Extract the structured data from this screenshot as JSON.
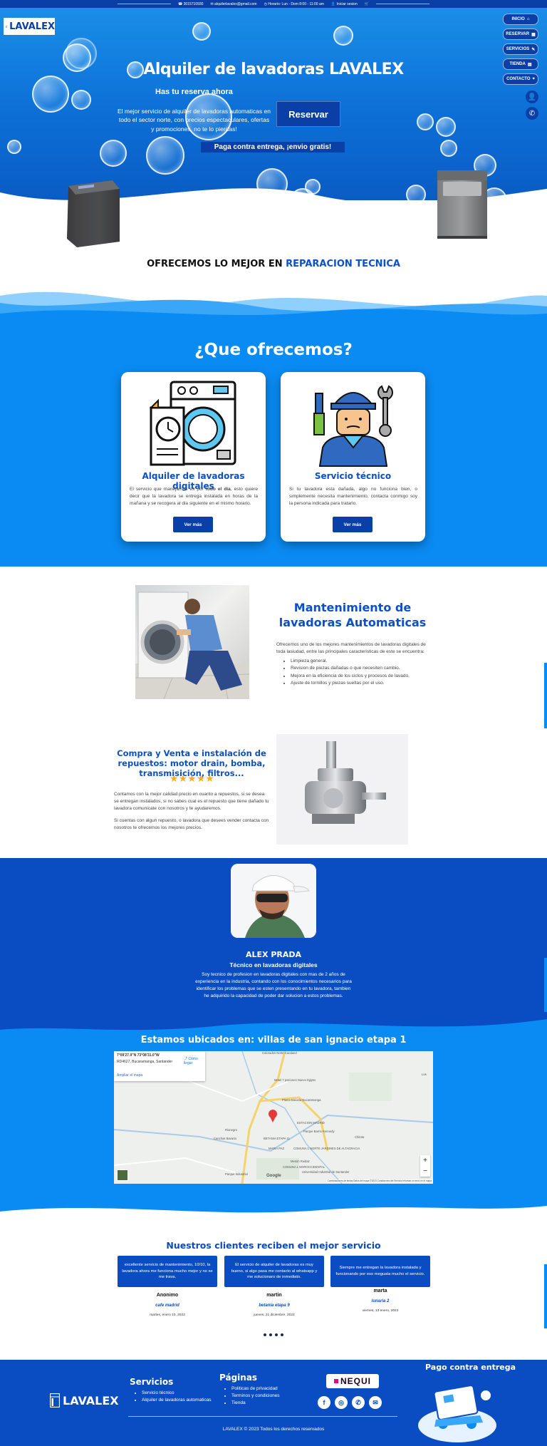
{
  "topbar": {
    "phone": "3015710930",
    "email": "alquilerlavalex@gmail.com",
    "hours": "Horario: Lun - Dom 8:00 - 11:00 am",
    "login": "Iniciar sesion"
  },
  "brand": {
    "name": "LAVALEX"
  },
  "nav": [
    {
      "label": "INICIO",
      "icon": "home-icon",
      "glyph": "⌂"
    },
    {
      "label": "RESERVAR",
      "icon": "calendar-icon",
      "glyph": "▦"
    },
    {
      "label": "SERVICIOS",
      "icon": "wrench-icon",
      "glyph": "✎"
    },
    {
      "label": "TIENDA",
      "icon": "store-icon",
      "glyph": "▤"
    },
    {
      "label": "CONTACTO",
      "icon": "location-icon",
      "glyph": "⌖"
    }
  ],
  "hero": {
    "title": "Alquiler de lavadoras LAVALEX",
    "subtitle": "Has tu reserva ahora",
    "description": "El mejor servicio de alquiler de lavadoras automaticas en todo el sector norte, con precios espectaculares, ofertas y promociones, no te lo pierdas!",
    "reserve_button": "Reservar",
    "pay_banner": "Paga contra entrega, ¡envio gratis!"
  },
  "offer_line": {
    "prefix": "OFRECEMOS LO MEJOR EN",
    "highlight": "REPARACION TECNICA"
  },
  "services": {
    "title": "¿Que ofrecemos?",
    "cards": [
      {
        "title": "Alquiler de lavadoras digitales",
        "text_pre": "El servicio que manejamos es por ",
        "text_bold": "todo el dia",
        "text_post": ", esto quiere decir que la lavadora se entrega instalada en horas de la mañana y se recogera al dia siguiente en el mismo horario.",
        "button": "Ver más"
      },
      {
        "title": "Servicio técnico",
        "text": "Si tu lavadora esta dañada, algo no funciona bien, o simplemente necesita mantenimiento, contacta conmigo soy la persona indicada para tratarlo.",
        "button": "Ver más"
      }
    ]
  },
  "maintenance": {
    "title": "Mantenimiento de lavadoras Automaticas",
    "description": "Ofrecemos uno de los mejores mantenimientos de lavadoras digitales de toda lasiudad, entre las principales caracteristicas de este se encuentra:",
    "items": [
      "Limpieza general.",
      "Revision de piezas dañadas o que necesiten cambio.",
      "Mejora en la eficiencia de los ciclos y procesos de lavado.",
      "Ajuste de tornillos y piezas sueltas por el uso."
    ]
  },
  "parts": {
    "title": "Compra y Venta e instalación de repuestos: motor drain, bomba, transmisición, filtros...",
    "rating": 5,
    "paragraph1": "Contamos con la mejor calidad precio en cuanto a repuestos, si se desea se entregan instalados, si no sabes cual es el repuesto que tiene dañado tu lavadora comunicate con nosotros y te ayudaremos.",
    "paragraph2": "Si cuentas con algun repuesto, o lavadora que desees vender contacta con nosotros te ofrecemos los mejores precios."
  },
  "profile": {
    "name": "ALEX PRADA",
    "role": "Técnico en lavadoras digitales",
    "description": "Soy tecnico de profesion en lavadoras digitales con mas de 2 años de experiencia en la industria, contando con los conocimientos necesarios para identificar los problemas que se esten presentando en tu lavadora, tambien he adquirido la capacidad de poder dar solucion a estos problemas."
  },
  "location": {
    "title": "Estamos ubicados en: villas de san ignacio etapa 1",
    "map": {
      "coords": "7°09'27.9\"N 73°08'31.0\"W",
      "address": "RD4627, Bucaramanga, Santander",
      "directions": "Cómo llegar",
      "enlarge": "Ampliar el mapa",
      "places": [
        "Colorados Norte Caraland",
        "Motel 7 pasiones Nuevo Egipto",
        "Planta Bavaria Bucaramanga",
        "ESTACION MADRID",
        "Parque Barrio Kennedy",
        "Rionegro",
        "Canchas Bavaria",
        "BETANIA ETAPA 11",
        "MARIA PAZ",
        "COMUNA 1 NORTE JARDINES DE ALTAGRACIA",
        "Chitota",
        "Mesón Ruidaz",
        "COMUNA 1 NOROCCIDENTAL",
        "Universidad Industrial de Santander",
        "Parque Industrial",
        "Los"
      ],
      "footer": "Combinaciones de teclas   Datos del mapa ©2023   Condiciones del Servicio   Informar un error en el mapa",
      "brand": "Google"
    }
  },
  "testimonials": {
    "title": "Nuestros clientes reciben el mejor servicio",
    "items": [
      {
        "quote": "excellente servicio de mantenimiento, 10/10, la lavadora ahora me funciona mucho mejor y no se me trava.",
        "name": "Anonimo",
        "place": "cafe madrid",
        "date": "martes, enero 10, 2023"
      },
      {
        "quote": "El servicio de alquiler de lavadoras es muy bueno, si algo pasa me contacto al whatsapp y me solucionaro de inmediato.",
        "name": "martin",
        "place": "betania etapa 9",
        "date": "jueves, 21 diciembre, 2022"
      },
      {
        "quote": "Siempre me entregan la lavadora instalada y funcionando por eso meguata mucho el servicio.",
        "name": "marta",
        "place": "lunaria 2",
        "date": "viernes, 13 enero, 2023"
      }
    ],
    "dots": 4
  },
  "footer": {
    "brand": "LAVALEX",
    "services_title": "Servicios",
    "services": [
      "Servicio técnico",
      "Alquiler de lavadoras automaticas"
    ],
    "pages_title": "Páginas",
    "pages": [
      "Politicas de privacidad",
      "Terminos y condiciones",
      "Tienda"
    ],
    "nequi": "NEQUI",
    "social": [
      {
        "icon": "facebook-icon",
        "glyph": "f"
      },
      {
        "icon": "instagram-icon",
        "glyph": "◎"
      },
      {
        "icon": "whatsapp-icon",
        "glyph": "✆"
      },
      {
        "icon": "email-icon",
        "glyph": "✉"
      }
    ],
    "pay_title": "Pago contra entrega",
    "copyright": "LAVALEX © 2023 Todos los derechos reservados"
  },
  "colors": {
    "primary": "#0a3fa8",
    "sky": "#0a8bf3",
    "heading_blue": "#0a50c8",
    "star": "#f2b01e"
  }
}
